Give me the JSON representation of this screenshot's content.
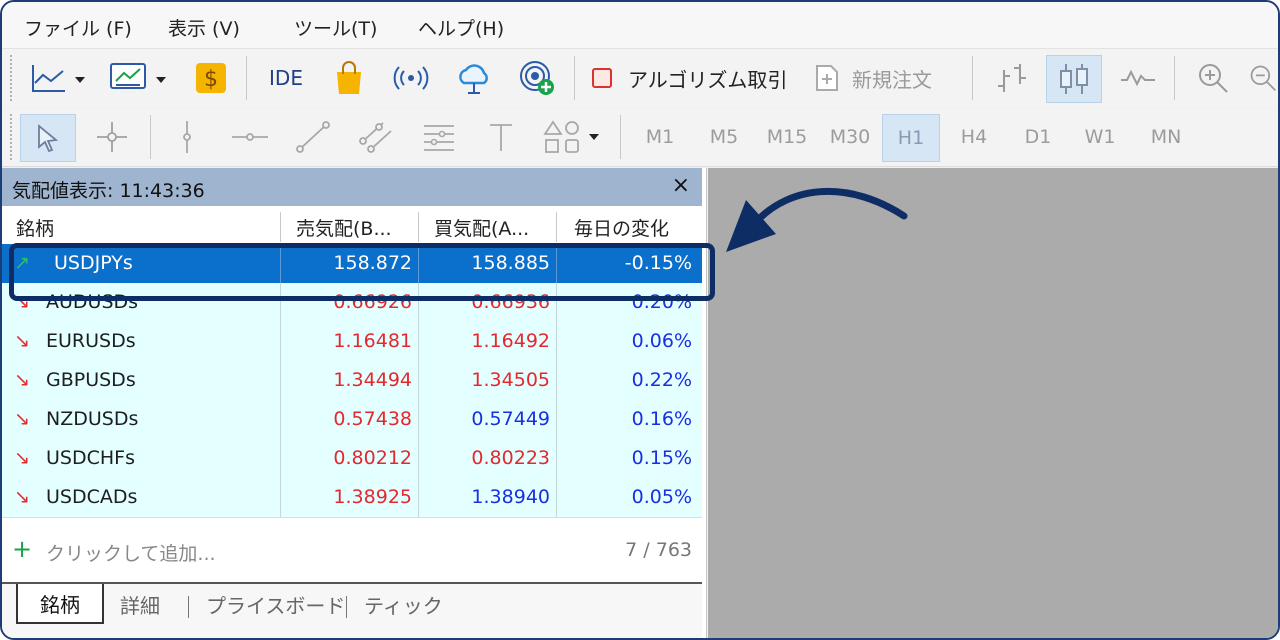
{
  "menu": [
    "ファイル (F)",
    "表示 (V)",
    "ツール(T)",
    "ヘルプ(H)"
  ],
  "toolbar": {
    "ide_label": "IDE",
    "algo_label": "アルゴリズム取引",
    "new_order_label": "新規注文"
  },
  "timeframes": [
    "M1",
    "M5",
    "M15",
    "M30",
    "H1",
    "H4",
    "D1",
    "W1",
    "MN"
  ],
  "timeframe_active": "H1",
  "market_watch": {
    "title": "気配値表示: 11:43:36",
    "close": "×",
    "columns": [
      "銘柄",
      "売気配(B...",
      "買気配(A...",
      "毎日の変化"
    ],
    "rows": [
      {
        "symbol": "USDJPYs",
        "bid": "158.872",
        "ask": "158.885",
        "change": "-0.15%",
        "direction": "up",
        "selected": true
      },
      {
        "symbol": "AUDUSDs",
        "bid": "0.66926",
        "ask": "0.66936",
        "change": "0.20%",
        "direction": "down"
      },
      {
        "symbol": "EURUSDs",
        "bid": "1.16481",
        "ask": "1.16492",
        "change": "0.06%",
        "direction": "down"
      },
      {
        "symbol": "GBPUSDs",
        "bid": "1.34494",
        "ask": "1.34505",
        "change": "0.22%",
        "direction": "down"
      },
      {
        "symbol": "NZDUSDs",
        "bid": "0.57438",
        "ask": "0.57449",
        "change": "0.16%",
        "direction": "down"
      },
      {
        "symbol": "USDCHFs",
        "bid": "0.80212",
        "ask": "0.80223",
        "change": "0.15%",
        "direction": "down"
      },
      {
        "symbol": "USDCADs",
        "bid": "1.38925",
        "ask": "1.38940",
        "change": "0.05%",
        "direction": "down"
      }
    ],
    "add_text": "クリックして追加...",
    "count": "7 / 763",
    "tabs": [
      "銘柄",
      "詳細",
      "プライスボード",
      "ティック"
    ]
  },
  "colors": {
    "selected_row": "#0b6fcc",
    "row_bg": "#e4ffff",
    "price_red": "#e5282d",
    "price_blue": "#1a2fe0",
    "highlight_border": "#0d2d64",
    "chart_bg": "#ababab"
  },
  "icons": [
    "line-chart-icon",
    "chart-template-icon",
    "dollar-icon",
    "shopping-bag-icon",
    "signal-icon",
    "cloud-icon",
    "vps-icon",
    "stop-square-icon",
    "new-order-icon",
    "bar-chart-icon",
    "candlestick-icon",
    "line-icon",
    "zoom-in-icon",
    "zoom-out-icon",
    "cursor-icon",
    "crosshair-icon",
    "vertical-line-icon",
    "horizontal-line-icon",
    "trendline-icon",
    "channel-icon",
    "fibonacci-icon",
    "text-icon",
    "shapes-icon",
    "callout-arrow-icon"
  ]
}
